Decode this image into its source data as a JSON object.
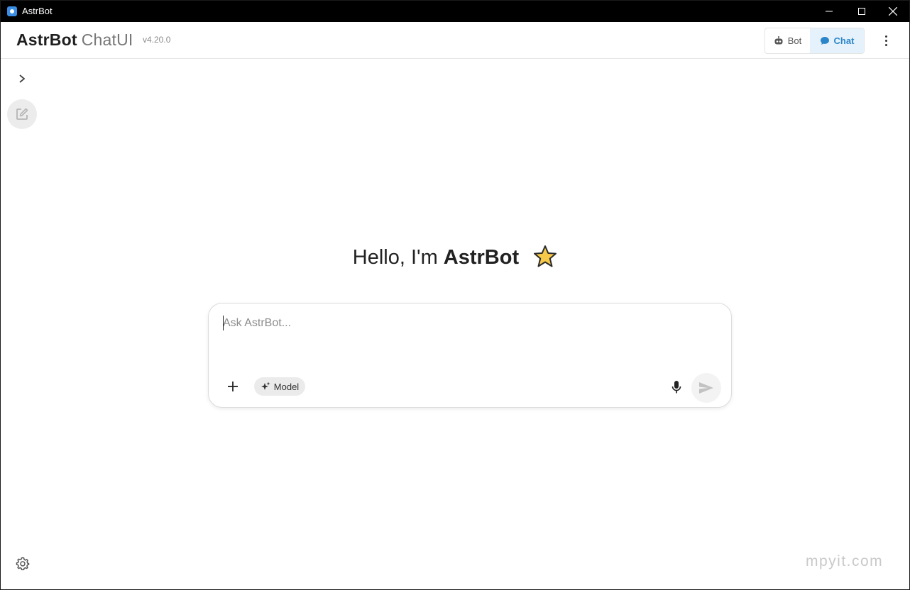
{
  "window": {
    "title": "AstrBot"
  },
  "header": {
    "brand_bold": "AstrBot",
    "brand_light": "ChatUI",
    "version": "v4.20.0",
    "modes": [
      {
        "label": "Bot",
        "icon": "robot-icon",
        "active": false
      },
      {
        "label": "Chat",
        "icon": "chat-bubble-icon",
        "active": true
      }
    ]
  },
  "greeting": {
    "prefix": "Hello, I'm ",
    "name": "AstrBot"
  },
  "composer": {
    "placeholder": "Ask AstrBot...",
    "value": "",
    "model_label": "Model"
  },
  "watermark": "mpyit.com",
  "colors": {
    "accent": "#2a86c9",
    "accent_bg": "#e6f2fb",
    "star": "#f7c948"
  }
}
